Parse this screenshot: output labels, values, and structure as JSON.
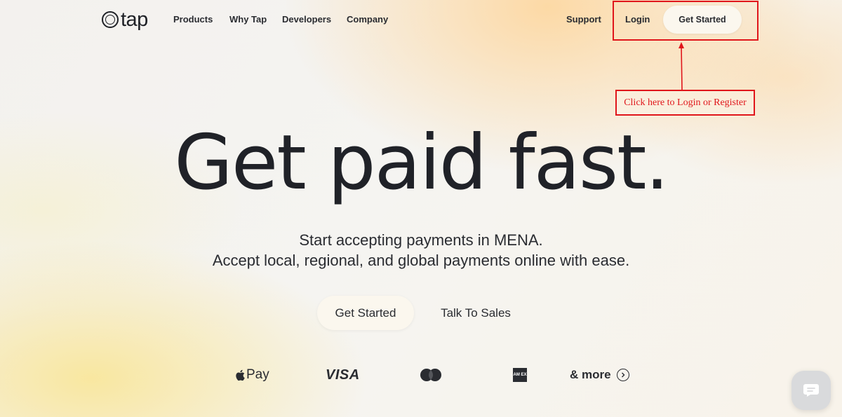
{
  "brand": {
    "name": "tap"
  },
  "nav": {
    "items": [
      {
        "label": "Products"
      },
      {
        "label": "Why Tap"
      },
      {
        "label": "Developers"
      },
      {
        "label": "Company"
      }
    ],
    "support": "Support",
    "login": "Login",
    "get_started": "Get Started"
  },
  "annotation": {
    "label": "Click here to Login or Register",
    "color": "#e0161b"
  },
  "hero": {
    "title": "Get paid fast.",
    "subtitle_line1": "Start accepting payments in MENA.",
    "subtitle_line2": "Accept local, regional, and global payments online with ease.",
    "primary_cta": "Get Started",
    "secondary_cta": "Talk To Sales"
  },
  "payment_methods": {
    "apple_pay": "Pay",
    "visa": "VISA",
    "mastercard_icon": "mastercard-icon",
    "amex_icon": "amex-icon",
    "amex_text": "AM EX",
    "more": "& more"
  },
  "chat": {
    "icon": "chat-icon"
  },
  "colors": {
    "text": "#1f2126",
    "button_bg": "#fbf7ee",
    "annotation": "#e0161b"
  }
}
